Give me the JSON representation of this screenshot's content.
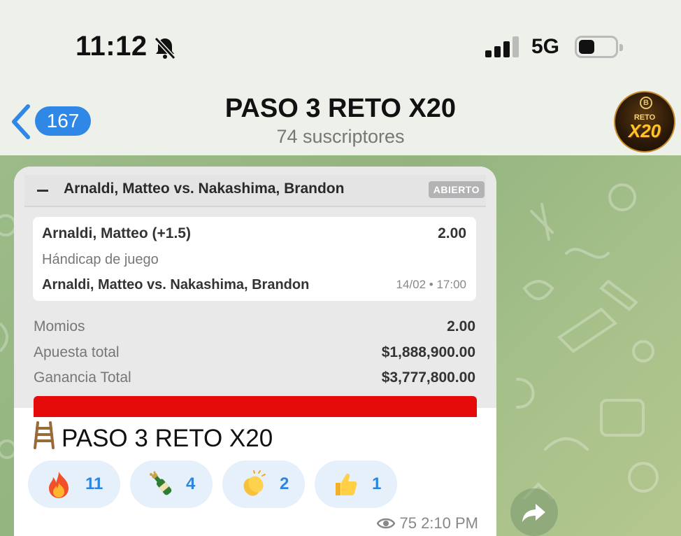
{
  "status_bar": {
    "time": "11:12",
    "network": "5G",
    "silent_icon": "bell-slash-icon"
  },
  "header": {
    "back_badge": "167",
    "title": "PASO 3 RETO X20",
    "subtitle": "74 suscriptores",
    "avatar_text_top": "RETO",
    "avatar_text_main": "X20",
    "avatar_logo": "B"
  },
  "bet_slip": {
    "match_title": "Arnaldi, Matteo vs. Nakashima, Brandon",
    "status": "ABIERTO",
    "selection": "Arnaldi, Matteo (+1.5)",
    "selection_odds": "2.00",
    "market": "Hándicap de juego",
    "event": "Arnaldi, Matteo vs. Nakashima, Brandon",
    "event_date": "14/02 • 17:00",
    "summary": [
      {
        "label": "Momios",
        "value": "2.00"
      },
      {
        "label": "Apuesta total",
        "value": "$1,888,900.00"
      },
      {
        "label": "Ganancia Total",
        "value": "$3,777,800.00"
      }
    ],
    "accent_color": "#e60b0b"
  },
  "message": {
    "caption": "PASO 3 RETO X20",
    "caption_icon": "ladder-icon",
    "views": "75",
    "time": "2:10 PM",
    "reactions": [
      {
        "emoji": "fire-icon",
        "count": "11"
      },
      {
        "emoji": "champagne-icon",
        "count": "4"
      },
      {
        "emoji": "clapping-hands-icon",
        "count": "2"
      },
      {
        "emoji": "thumbs-up-icon",
        "count": "1"
      }
    ]
  },
  "colors": {
    "accent": "#2f88e6",
    "reaction_bg": "#e5f0fb",
    "wallpaper": "#9cbb88"
  }
}
